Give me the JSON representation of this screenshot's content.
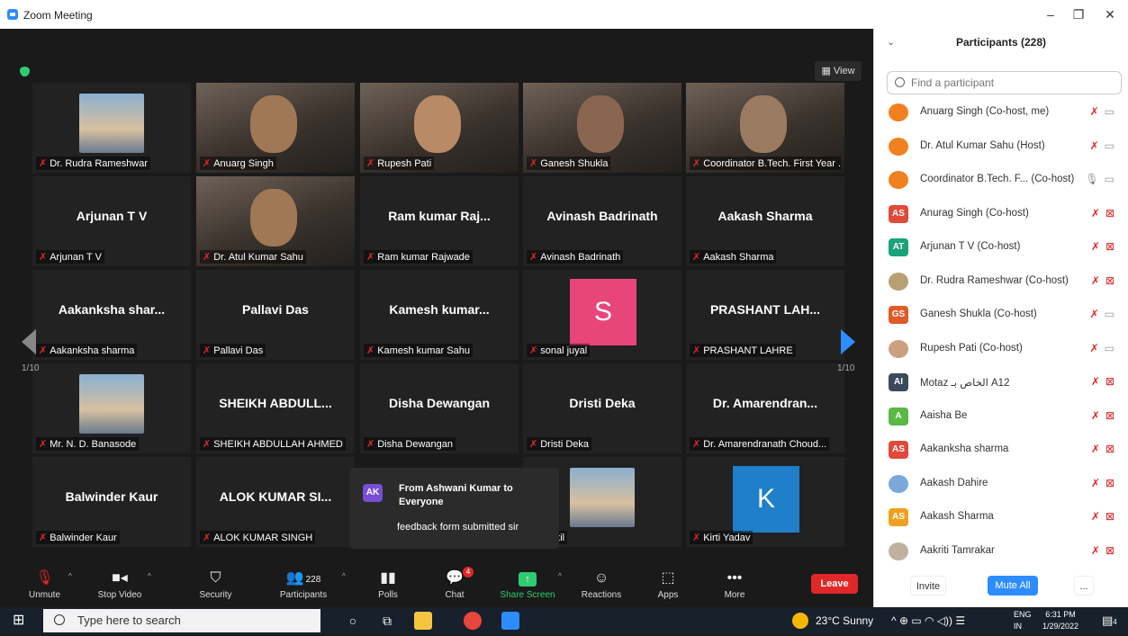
{
  "window": {
    "title": "Zoom Meeting",
    "minimize": "–",
    "restore": "❐",
    "close": "✕"
  },
  "view_button": "▦ View",
  "page_left": "1/10",
  "page_right": "1/10",
  "tiles": [
    {
      "label": "Dr. Rudra Rameshwar",
      "type": "photo"
    },
    {
      "label": "Anuarg Singh",
      "type": "video"
    },
    {
      "label": "Rupesh Pati",
      "type": "video"
    },
    {
      "label": "Ganesh Shukla",
      "type": "video"
    },
    {
      "label": "Coordinator B.Tech. First Year ...",
      "type": "video",
      "active": true
    },
    {
      "name": "Arjunan T V",
      "label": "Arjunan T V"
    },
    {
      "label": "Dr. Atul Kumar Sahu",
      "type": "video"
    },
    {
      "name": "Ram kumar Raj...",
      "label": "Ram kumar Rajwade"
    },
    {
      "name": "Avinash Badrinath",
      "label": "Avinash Badrinath"
    },
    {
      "name": "Aakash Sharma",
      "label": "Aakash Sharma"
    },
    {
      "name": "Aakanksha shar...",
      "label": "Aakanksha sharma"
    },
    {
      "name": "Pallavi Das",
      "label": "Pallavi Das"
    },
    {
      "name": "Kamesh kumar...",
      "label": "Kamesh kumar Sahu"
    },
    {
      "label": "sonal juyal",
      "letter": "S",
      "color": "#e8457a"
    },
    {
      "name": "PRASHANT LAH...",
      "label": "PRASHANT LAHRE"
    },
    {
      "label": "Mr. N. D. Banasode",
      "type": "photo"
    },
    {
      "name": "SHEIKH ABDULL...",
      "label": "SHEIKH ABDULLAH AHMED"
    },
    {
      "name": "Disha Dewangan",
      "label": "Disha Dewangan"
    },
    {
      "name": "Dristi Deka",
      "label": "Dristi Deka"
    },
    {
      "name": "Dr. Amarendran...",
      "label": "Dr. Amarendranath Choud..."
    },
    {
      "name": "Balwinder Kaur",
      "label": "Balwinder Kaur"
    },
    {
      "name": "ALOK KUMAR SI...",
      "label": "ALOK KUMAR SINGH"
    },
    {
      "label": "",
      "hidden": true
    },
    {
      "label": "l Patil",
      "type": "photo"
    },
    {
      "label": "Kirti Yadav",
      "letter": "K",
      "color": "#1f7fc9"
    }
  ],
  "chat_popup": {
    "avatar": "AK",
    "from": "From Ashwani Kumar to Everyone",
    "message": "feedback form submitted sir"
  },
  "toolbar": {
    "unmute": "Unmute",
    "stop_video": "Stop Video",
    "security": "Security",
    "participants": "Participants",
    "participants_count": "228",
    "polls": "Polls",
    "chat": "Chat",
    "chat_badge": "4",
    "share_screen": "Share Screen",
    "reactions": "Reactions",
    "apps": "Apps",
    "more": "More",
    "leave": "Leave"
  },
  "panel": {
    "title": "Participants (228)",
    "search_placeholder": "Find a participant",
    "participants": [
      {
        "name": "Anuarg Singh (Co-host, me)",
        "avatar": "",
        "color": "#f08020",
        "cam": "on"
      },
      {
        "name": "Dr. Atul Kumar Sahu (Host)",
        "avatar": "",
        "color": "#f08020",
        "cam": "on"
      },
      {
        "name": "Coordinator B.Tech. F... (Co-host)",
        "avatar": "",
        "color": "#f08020",
        "cam": "on",
        "mic": "on"
      },
      {
        "name": "Anurag Singh (Co-host)",
        "avatar": "AS",
        "color": "#e04a3a",
        "cam": "off"
      },
      {
        "name": "Arjunan T V (Co-host)",
        "avatar": "AT",
        "color": "#1aa37a",
        "cam": "off"
      },
      {
        "name": "Dr. Rudra Rameshwar (Co-host)",
        "avatar": "",
        "color": "#b8a070",
        "cam": "off"
      },
      {
        "name": "Ganesh Shukla (Co-host)",
        "avatar": "GS",
        "color": "#e05a2a",
        "cam": "on"
      },
      {
        "name": "Rupesh Pati (Co-host)",
        "avatar": "",
        "color": "#caa080",
        "cam": "on"
      },
      {
        "name": "Motaz الخاص بـ A12",
        "avatar": "AI",
        "color": "#3a4a5a",
        "cam": "off"
      },
      {
        "name": "Aaisha Be",
        "avatar": "A",
        "color": "#5ab845",
        "cam": "off"
      },
      {
        "name": "Aakanksha sharma",
        "avatar": "AS",
        "color": "#e04a3a",
        "cam": "off"
      },
      {
        "name": "Aakash Dahire",
        "avatar": "",
        "color": "#7aa8d8",
        "cam": "off"
      },
      {
        "name": "Aakash Sharma",
        "avatar": "AS",
        "color": "#f0a020",
        "cam": "off"
      },
      {
        "name": "Aakriti Tamrakar",
        "avatar": "",
        "color": "#c0b0a0",
        "cam": "off"
      }
    ],
    "invite": "Invite",
    "mute_all": "Mute All",
    "more": "..."
  },
  "taskbar": {
    "search_placeholder": "Type here to search",
    "weather": "23°C  Sunny",
    "lang1": "ENG",
    "lang2": "IN",
    "time": "6:31 PM",
    "date": "1/29/2022",
    "notif": "4"
  }
}
